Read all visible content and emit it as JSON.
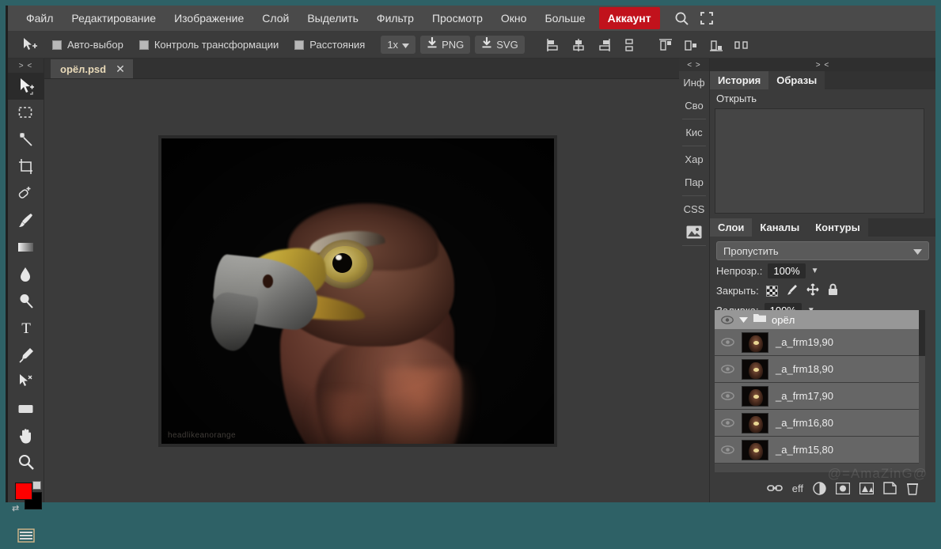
{
  "app": {
    "accent_red": "#c1121c",
    "frame_color": "#2e6166",
    "panel_bg": "#3b3b3b"
  },
  "menubar": {
    "items": [
      {
        "label": "Файл",
        "name": "menu-file"
      },
      {
        "label": "Редактирование",
        "name": "menu-edit"
      },
      {
        "label": "Изображение",
        "name": "menu-image"
      },
      {
        "label": "Слой",
        "name": "menu-layer"
      },
      {
        "label": "Выделить",
        "name": "menu-select"
      },
      {
        "label": "Фильтр",
        "name": "menu-filter"
      },
      {
        "label": "Просмотр",
        "name": "menu-view"
      },
      {
        "label": "Окно",
        "name": "menu-window"
      },
      {
        "label": "Больше",
        "name": "menu-more"
      }
    ],
    "account_label": "Аккаунт",
    "search_icon": "search-icon",
    "fullscreen_icon": "fullscreen-icon"
  },
  "optionsbar": {
    "move_tool_icon": "move-tool-icon",
    "checkboxes": [
      {
        "label": "Авто-выбор",
        "name": "auto-select-checkbox",
        "checked": false
      },
      {
        "label": "Контроль трансформации",
        "name": "transform-controls-checkbox",
        "checked": false
      },
      {
        "label": "Расстояния",
        "name": "distances-checkbox",
        "checked": false
      }
    ],
    "zoom_select": "1x",
    "export_png": "PNG",
    "export_svg": "SVG",
    "align_icons": [
      "align-left-icon",
      "align-center-horizontal-icon",
      "align-right-icon",
      "distribute-vertical-icon",
      "align-top-icon",
      "align-middle-icon",
      "align-bottom-icon",
      "distribute-horizontal-icon"
    ]
  },
  "toolbox": {
    "collapse_label": "> <",
    "tools": [
      {
        "name": "move-tool",
        "icon": "move-tool-icon",
        "active": true
      },
      {
        "name": "marquee-tool",
        "icon": "rect-marquee-icon",
        "active": false
      },
      {
        "name": "magic-wand-tool",
        "icon": "magic-wand-icon",
        "active": false
      },
      {
        "name": "crop-tool",
        "icon": "crop-icon",
        "active": false
      },
      {
        "name": "healing-brush-tool",
        "icon": "healing-brush-icon",
        "active": false
      },
      {
        "name": "brush-tool",
        "icon": "brush-icon",
        "active": false
      },
      {
        "name": "gradient-tool",
        "icon": "gradient-icon",
        "active": false
      },
      {
        "name": "blur-tool",
        "icon": "water-drop-icon",
        "active": false
      },
      {
        "name": "dodge-tool",
        "icon": "dodge-icon",
        "active": false
      },
      {
        "name": "type-tool",
        "icon": "text-t-icon",
        "active": false
      },
      {
        "name": "pen-tool",
        "icon": "pen-icon",
        "active": false
      },
      {
        "name": "path-select-tool",
        "icon": "path-select-icon",
        "active": false
      },
      {
        "name": "shape-tool",
        "icon": "rectangle-shape-icon",
        "active": false
      },
      {
        "name": "hand-tool",
        "icon": "hand-icon",
        "active": false
      },
      {
        "name": "zoom-tool",
        "icon": "magnifier-icon",
        "active": false
      }
    ],
    "foreground_color": "#ff0000",
    "background_color": "#000000",
    "swap_icon": "swap-colors-icon",
    "screen_mode_icon": "screen-mode-icon"
  },
  "document": {
    "tab_title": "орёл.psd",
    "close_icon": "close-icon",
    "watermark": "headlikeanorange"
  },
  "rail": {
    "collapse_label": "< >",
    "items": [
      {
        "label": "Инф",
        "name": "rail-info"
      },
      {
        "label": "Сво",
        "name": "rail-properties"
      },
      {
        "label": "Кис",
        "name": "rail-brushes"
      },
      {
        "label": "Хар",
        "name": "rail-character"
      },
      {
        "label": "Пар",
        "name": "rail-paragraph"
      },
      {
        "label": "CSS",
        "name": "rail-css"
      }
    ],
    "image_icon": "image-icon"
  },
  "history_panel": {
    "collapse_label": "> <",
    "tabs": [
      {
        "label": "История",
        "name": "tab-history",
        "selected": true
      },
      {
        "label": "Образы",
        "name": "tab-snapshots",
        "selected": false
      }
    ],
    "entries": [
      "Открыть"
    ]
  },
  "layers_panel": {
    "tabs": [
      {
        "label": "Слои",
        "name": "tab-layers",
        "selected": true
      },
      {
        "label": "Каналы",
        "name": "tab-channels",
        "selected": false
      },
      {
        "label": "Контуры",
        "name": "tab-paths",
        "selected": false
      }
    ],
    "blend_mode": "Пропустить",
    "opacity_label": "Непрозр.:",
    "opacity_value": "100%",
    "lock_label": "Закрыть:",
    "lock_icons": [
      "lock-transparency-icon",
      "lock-pixels-icon",
      "lock-position-icon",
      "lock-all-icon"
    ],
    "fill_label": "Заливка:",
    "fill_value": "100%",
    "group": {
      "name": "орёл",
      "eye_icon": "eye-icon",
      "folder_icon": "folder-icon",
      "expand_icon": "chevron-down-icon"
    },
    "layers": [
      {
        "name": "_a_frm19,90",
        "visible": false
      },
      {
        "name": "_a_frm18,90",
        "visible": false
      },
      {
        "name": "_a_frm17,90",
        "visible": false
      },
      {
        "name": "_a_frm16,80",
        "visible": false
      },
      {
        "name": "_a_frm15,80",
        "visible": false
      }
    ],
    "footer_icons": [
      {
        "name": "link-layers-icon",
        "glyph": "link"
      },
      {
        "name": "layer-effects-icon",
        "glyph": "eff"
      },
      {
        "name": "adjustment-layer-icon",
        "glyph": "halfcircle"
      },
      {
        "name": "layer-mask-icon",
        "glyph": "mask"
      },
      {
        "name": "new-group-icon",
        "glyph": "group"
      },
      {
        "name": "new-layer-icon",
        "glyph": "newlayer"
      },
      {
        "name": "delete-layer-icon",
        "glyph": "trash"
      }
    ],
    "watermark": "@=AmaZinG@"
  }
}
